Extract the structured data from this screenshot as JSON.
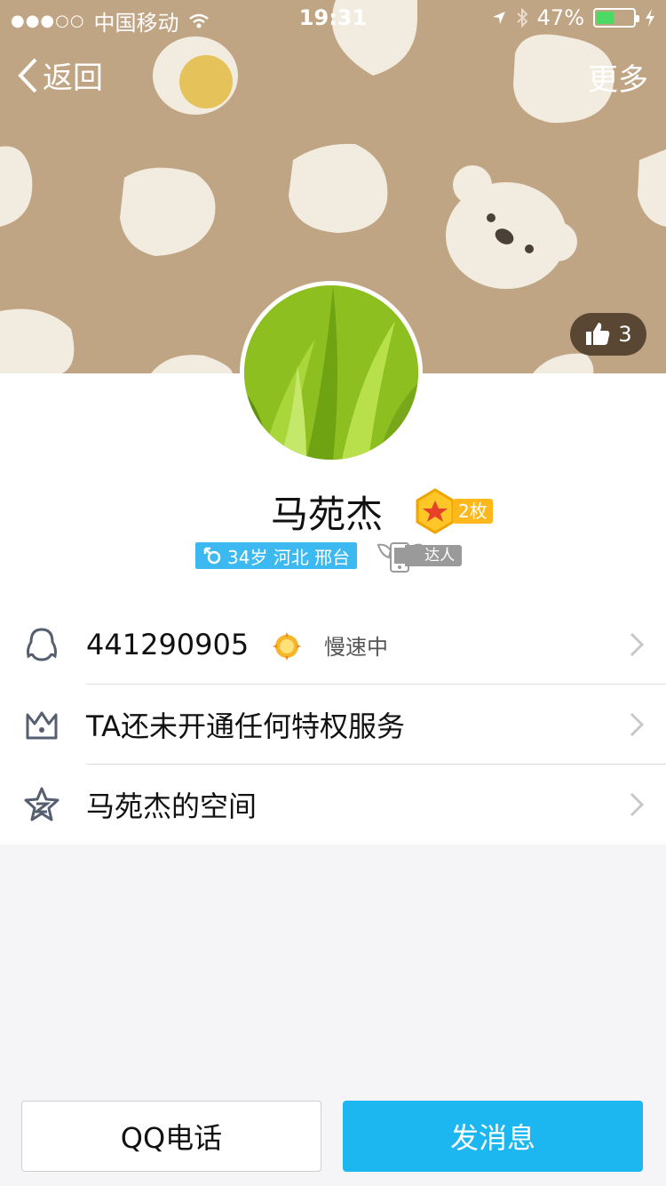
{
  "status_bar": {
    "signal": "●●●○○",
    "carrier": "中国移动",
    "time": "19:31",
    "battery": "47%",
    "battery_level": 0.47
  },
  "nav": {
    "back_label": "返回",
    "more_label": "更多"
  },
  "likes": {
    "count": "3"
  },
  "profile": {
    "name": "马苑杰",
    "medal_count": "2枚",
    "info_tag": "34岁 河北 邢台",
    "badge_label": "达人"
  },
  "rows": [
    {
      "text": "441290905",
      "status": "慢速中"
    },
    {
      "text": "TA还未开通任何特权服务"
    },
    {
      "text": "马苑杰的空间"
    }
  ],
  "actions": {
    "call": "QQ电话",
    "message": "发消息"
  },
  "colors": {
    "banner": "#c0a584",
    "accent_blue": "#1cb7f0",
    "tag_blue": "#3db9f2",
    "medal_gold": "#ffb81c"
  }
}
